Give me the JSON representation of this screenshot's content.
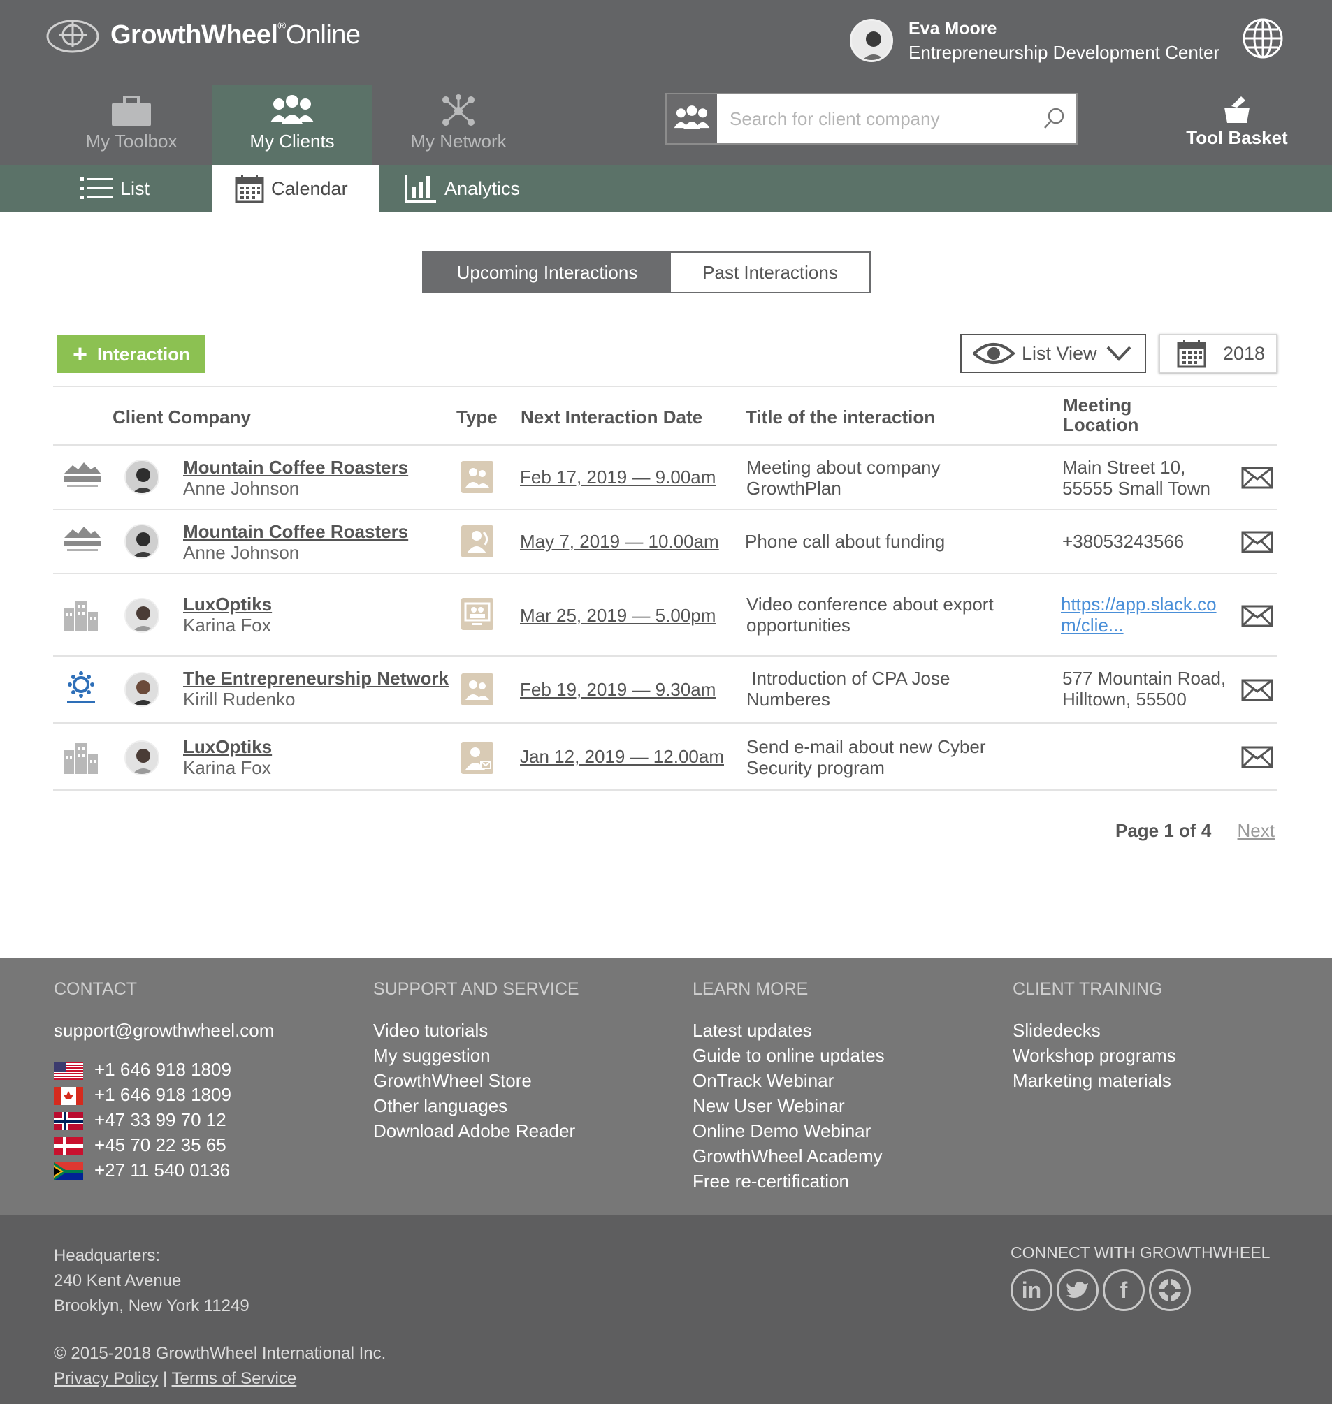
{
  "brand": {
    "name_bold": "GrowthWheel",
    "registered": "®",
    "name_light": "Online"
  },
  "user": {
    "name": "Eva Moore",
    "org": "Entrepreneurship Development Center"
  },
  "nav": {
    "tabs": [
      {
        "label": "My Toolbox",
        "icon": "toolbox-icon",
        "active": false
      },
      {
        "label": "My Clients",
        "icon": "clients-icon",
        "active": true
      },
      {
        "label": "My Network",
        "icon": "network-icon",
        "active": false
      }
    ],
    "search_placeholder": "Search for client company",
    "tool_basket": "Tool Basket"
  },
  "subnav": {
    "tabs": [
      {
        "label": "List",
        "icon": "list-icon",
        "active": false
      },
      {
        "label": "Calendar",
        "icon": "calendar-icon",
        "active": true
      },
      {
        "label": "Analytics",
        "icon": "bar-chart-icon",
        "active": false
      }
    ]
  },
  "interactions_toggle": {
    "upcoming": "Upcoming Interactions",
    "past": "Past Interactions"
  },
  "toolbar": {
    "add_label": "Interaction",
    "view_label": "List View",
    "year": "2018"
  },
  "table": {
    "headers": {
      "company": "Client Company",
      "type": "Type",
      "date": "Next Interaction Date",
      "title": "Title of the interaction",
      "location": "Meeting Location"
    },
    "rows": [
      {
        "company": "Mountain Coffee Roasters",
        "person": "Anne Johnson",
        "logo": "mountain-logo",
        "date": "Feb 17, 2019 — 9.00am",
        "title": "Meeting about company GrowthPlan",
        "location": "Main Street 10, 55555 Small Town",
        "location_link": false
      },
      {
        "company": "Mountain Coffee Roasters",
        "person": "Anne Johnson",
        "logo": "mountain-logo",
        "date": "May 7, 2019 — 10.00am",
        "title": "Phone call about funding",
        "location": "+38053243566",
        "location_link": false
      },
      {
        "company": "LuxOptiks",
        "person": "Karina Fox",
        "logo": "building-logo",
        "date": "Mar 25, 2019 — 5.00pm",
        "title": "Video conference about export opportunities",
        "location": "https://app.slack.com/clie...",
        "location_link": true
      },
      {
        "company": "The Entrepreneurship Network",
        "person": "Kirill Rudenko",
        "logo": "network-logo",
        "date": "Feb 19, 2019 — 9.30am",
        "title": " Introduction of CPA Jose Numberes",
        "location": "577 Mountain Road, Hilltown, 55500",
        "location_link": false
      },
      {
        "company": "LuxOptiks",
        "person": "Karina Fox",
        "logo": "building-logo",
        "date": "Jan 12, 2019 — 12.00am",
        "title": "Send e-mail about new Cyber Security program",
        "location": "",
        "location_link": false
      }
    ]
  },
  "pager": {
    "page": "Page 1 of 4",
    "next": "Next"
  },
  "footer": {
    "contact": {
      "heading": "CONTACT",
      "email": "support@growthwheel.com",
      "phones": [
        {
          "flag": "us",
          "number": "+1 646 918 1809"
        },
        {
          "flag": "ca",
          "number": "+1 646 918 1809"
        },
        {
          "flag": "no",
          "number": "+47 33 99 70 12"
        },
        {
          "flag": "dk",
          "number": "+45 70 22 35 65"
        },
        {
          "flag": "za",
          "number": "+27 11 540 0136"
        }
      ]
    },
    "support": {
      "heading": "SUPPORT AND SERVICE",
      "items": [
        "Video tutorials",
        "My suggestion",
        "GrowthWheel Store",
        "Other languages",
        "Download Adobe Reader"
      ]
    },
    "learn": {
      "heading": "LEARN MORE",
      "items": [
        "Latest updates",
        "Guide to online updates",
        "OnTrack Webinar",
        "New User Webinar",
        "Online Demo Webinar",
        "GrowthWheel Academy",
        "Free re-certification"
      ]
    },
    "training": {
      "heading": "CLIENT TRAINING",
      "items": [
        "Slidedecks",
        "Workshop programs",
        "Marketing materials"
      ]
    },
    "hq": {
      "line1": "Headquarters:",
      "line2": "240 Kent Avenue",
      "line3": "Brooklyn, New York 11249"
    },
    "copyright": "© 2015-2018 GrowthWheel International Inc.",
    "privacy": "Privacy Policy",
    "sep": "|",
    "terms": "Terms of Service",
    "connect": "CONNECT WITH GROWTHWHEEL",
    "social": [
      {
        "icon": "linkedin-icon",
        "glyph": "in"
      },
      {
        "icon": "twitter-icon",
        "glyph": "t"
      },
      {
        "icon": "facebook-icon",
        "glyph": "f"
      },
      {
        "icon": "growthwheel-icon",
        "glyph": ""
      }
    ]
  }
}
